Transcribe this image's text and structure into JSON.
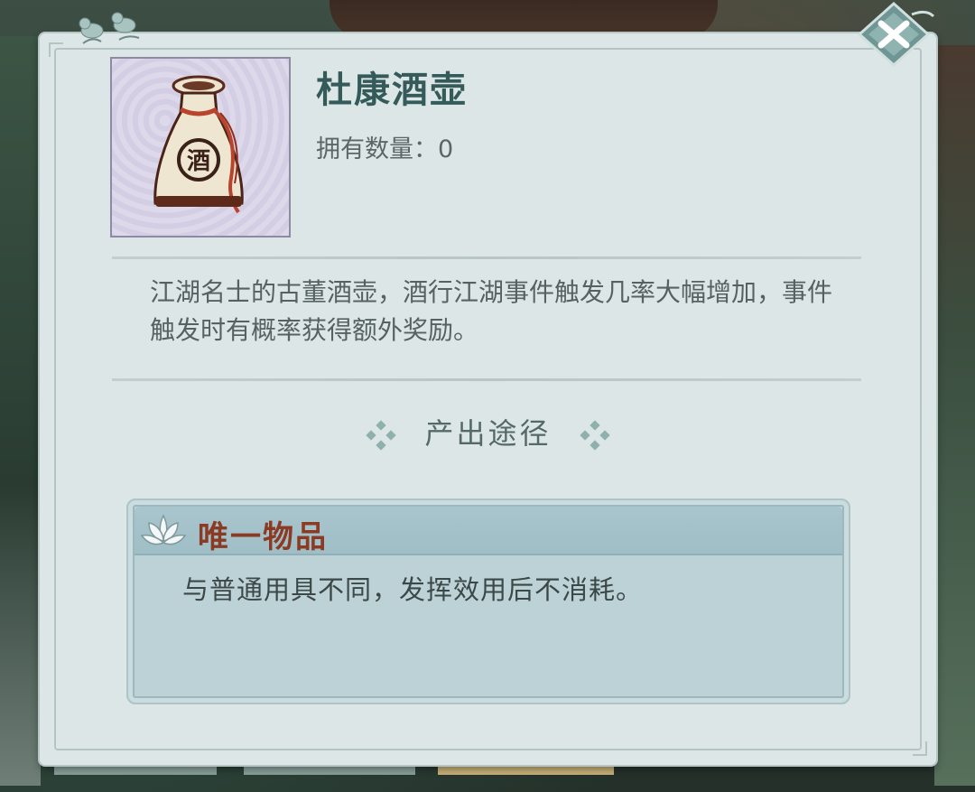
{
  "item": {
    "name": "杜康酒壶",
    "owned_label": "拥有数量：",
    "owned_count": "0",
    "description": "江湖名士的古董酒壶，酒行江湖事件触发几率大幅增加，事件触发时有概率获得额外奖励。",
    "icon": "wine-pot-icon",
    "pot_character": "酒"
  },
  "source": {
    "heading": "产出途径"
  },
  "unique": {
    "title": "唯一物品",
    "text": "与普通用具不同，发挥效用后不消耗。",
    "icon": "lotus-icon"
  },
  "controls": {
    "close_icon": "close-icon"
  },
  "colors": {
    "title": "#355a5a",
    "unique_title": "#8b3a24",
    "panel_bg": "#dce6e6",
    "unique_bg": "#bdd2d6"
  }
}
